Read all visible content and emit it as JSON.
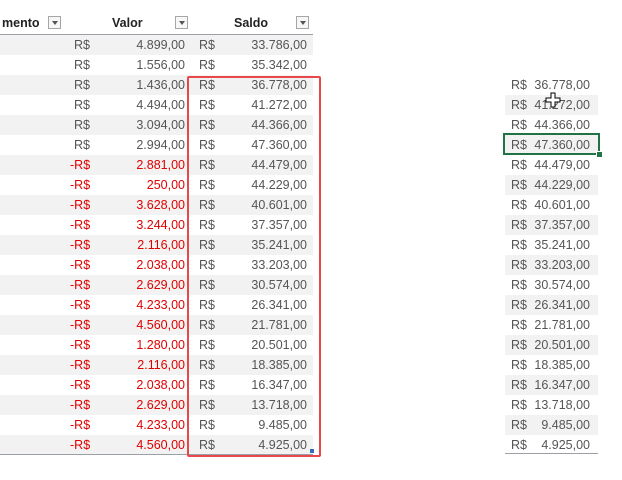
{
  "header": {
    "col1": "mento",
    "col2": "Valor",
    "col3": "Saldo"
  },
  "currency": "R$",
  "neg_currency": "-R$",
  "left_rows": [
    {
      "neg": false,
      "valor": "4.899,00",
      "saldo": "33.786,00"
    },
    {
      "neg": false,
      "valor": "1.556,00",
      "saldo": "35.342,00"
    },
    {
      "neg": false,
      "valor": "1.436,00",
      "saldo": "36.778,00"
    },
    {
      "neg": false,
      "valor": "4.494,00",
      "saldo": "41.272,00"
    },
    {
      "neg": false,
      "valor": "3.094,00",
      "saldo": "44.366,00"
    },
    {
      "neg": false,
      "valor": "2.994,00",
      "saldo": "47.360,00"
    },
    {
      "neg": true,
      "valor": "2.881,00",
      "saldo": "44.479,00"
    },
    {
      "neg": true,
      "valor": "250,00",
      "saldo": "44.229,00"
    },
    {
      "neg": true,
      "valor": "3.628,00",
      "saldo": "40.601,00"
    },
    {
      "neg": true,
      "valor": "3.244,00",
      "saldo": "37.357,00"
    },
    {
      "neg": true,
      "valor": "2.116,00",
      "saldo": "35.241,00"
    },
    {
      "neg": true,
      "valor": "2.038,00",
      "saldo": "33.203,00"
    },
    {
      "neg": true,
      "valor": "2.629,00",
      "saldo": "30.574,00"
    },
    {
      "neg": true,
      "valor": "4.233,00",
      "saldo": "26.341,00"
    },
    {
      "neg": true,
      "valor": "4.560,00",
      "saldo": "21.781,00"
    },
    {
      "neg": true,
      "valor": "1.280,00",
      "saldo": "20.501,00"
    },
    {
      "neg": true,
      "valor": "2.116,00",
      "saldo": "18.385,00"
    },
    {
      "neg": true,
      "valor": "2.038,00",
      "saldo": "16.347,00"
    },
    {
      "neg": true,
      "valor": "2.629,00",
      "saldo": "13.718,00"
    },
    {
      "neg": true,
      "valor": "4.233,00",
      "saldo": "9.485,00"
    },
    {
      "neg": true,
      "valor": "4.560,00",
      "saldo": "4.925,00"
    }
  ],
  "right_values": [
    "36.778,00",
    "41.272,00",
    "44.366,00",
    "47.360,00",
    "44.479,00",
    "44.229,00",
    "40.601,00",
    "37.357,00",
    "35.241,00",
    "33.203,00",
    "30.574,00",
    "26.341,00",
    "21.781,00",
    "20.501,00",
    "18.385,00",
    "16.347,00",
    "13.718,00",
    "9.485,00",
    "4.925,00"
  ],
  "selected_right_index": 3,
  "colors": {
    "negative": "#e00000",
    "highlight_border": "#e8474b",
    "selection": "#217346"
  }
}
